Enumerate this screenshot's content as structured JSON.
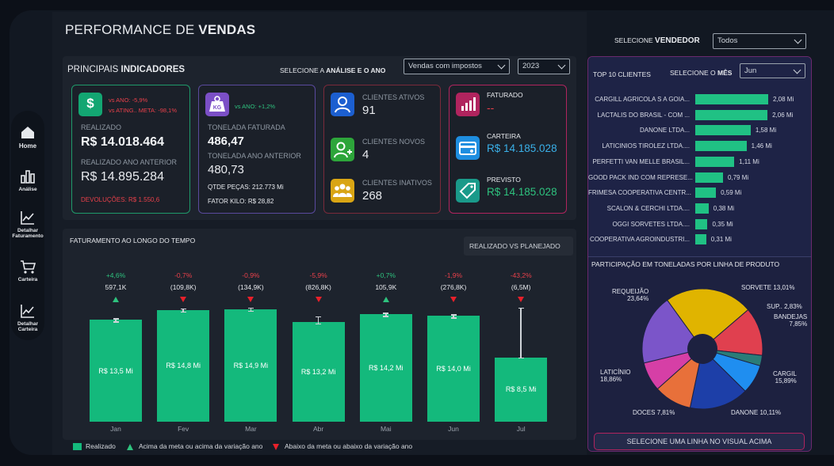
{
  "sidebar": {
    "items": [
      {
        "label": "Home",
        "icon": "home-icon"
      },
      {
        "label": "Análise",
        "icon": "bar-chart-icon"
      },
      {
        "label": "Detalhar Faturamento",
        "icon": "line-chart-icon"
      },
      {
        "label": "Carteira",
        "icon": "cart-icon"
      },
      {
        "label": "Detalhar Carteira",
        "icon": "line-chart-icon"
      }
    ]
  },
  "header": {
    "title_plain": "PERFORMANCE DE ",
    "title_bold": "VENDAS",
    "seller_label_plain": "SELECIONE ",
    "seller_label_bold": "VENDEDOR",
    "seller_value": "Todos"
  },
  "indicators": {
    "title_plain": "PRINCIPAIS ",
    "title_bold": "INDICADORES",
    "select_label_plain": "SELECIONE A ",
    "select_label_bold": "ANÁLISE E O ANO",
    "analysis_value": "Vendas com impostos",
    "year_value": "2023",
    "card1": {
      "vs_ano": "vs ANO: -5,9%",
      "vs_meta": "vs ATING.. META: -98,1%",
      "realizado_label": "REALIZADO",
      "realizado_value": "R$ 14.018.464",
      "anterior_label": "REALIZADO ANO ANTERIOR",
      "anterior_value": "R$ 14.895.284",
      "devolucoes": "DEVOLUÇÕES: R$ 1.550,6"
    },
    "card2": {
      "vs_ano": "vs ANO: +1,2%",
      "faturada_label": "TONELADA FATURADA",
      "faturada_value": "486,47",
      "anterior_label": "TONELADA ANO ANTERIOR",
      "anterior_value": "480,73",
      "qtde": "QTDE PEÇAS: 212.773 Mi",
      "fator": "FATOR KILO: R$ 28,82"
    },
    "card3": {
      "ativos_label": "CLIENTES ATIVOS",
      "ativos_value": "91",
      "novos_label": "CLIENTES NOVOS",
      "novos_value": "4",
      "inativos_label": "CLIENTES INATIVOS",
      "inativos_value": "268"
    },
    "card4": {
      "faturado_label": "FATURADO",
      "faturado_value": "--",
      "carteira_label": "CARTEIRA",
      "carteira_value": "R$ 14.185.028",
      "previsto_label": "PREVISTO",
      "previsto_value": "R$ 14.185.028"
    }
  },
  "colors": {
    "accent_green": "#14b97c",
    "accent_red": "#e8404a",
    "panel_border_purple": "#6b2a6e"
  },
  "billing": {
    "title": "FATURAMENTO AO LONGO DO TEMPO",
    "button": "REALIZADO VS PLANEJADO"
  },
  "chart_data": [
    {
      "type": "bar",
      "categories": [
        "Jan",
        "Fev",
        "Mar",
        "Abr",
        "Mai",
        "Jun",
        "Jul"
      ],
      "values": [
        13.5,
        14.8,
        14.9,
        13.2,
        14.2,
        14.0,
        8.5
      ],
      "labels": [
        "R$ 13,5 Mi",
        "R$ 14,8 Mi",
        "R$ 14,9 Mi",
        "R$ 13,2 Mi",
        "R$ 14,2 Mi",
        "R$ 14,0 Mi",
        "R$ 8,5 Mi"
      ],
      "deltas": [
        "+4,6%",
        "-0,7%",
        "-0,9%",
        "-5,9%",
        "+0,7%",
        "-1,9%",
        "-43,2%"
      ],
      "delta_values": [
        "597,1K",
        "(109,8K)",
        "(134,9K)",
        "(826,8K)",
        "105,9K",
        "(276,8K)",
        "(6,5M)"
      ],
      "direction": [
        "up",
        "down",
        "down",
        "down",
        "up",
        "down",
        "down"
      ],
      "series": [
        {
          "name": "Realizado"
        }
      ],
      "legend": [
        "Realizado",
        "Acima da meta ou acima da variação ano",
        "Abaixo da meta ou abaixo da  variação ano"
      ]
    },
    {
      "type": "bar",
      "title_plain": "TOP 10 CLIENTES",
      "month_label_plain": "SELECIONE O ",
      "month_label_bold": "MÊS",
      "month_value": "Jun",
      "categories": [
        "CARGILL AGRICOLA S A GOIA...",
        "LACTALIS DO BRASIL - COM ...",
        "DANONE LTDA...",
        "LATICINIOS TIROLEZ LTDA....",
        "PERFETTI VAN MELLE BRASIL...",
        "GOOD PACK IND COM REPRESE...",
        "FRIMESA COOPERATIVA CENTR...",
        "SCALON & CERCHI LTDA....",
        "OGGI SORVETES LTDA....",
        "COOPERATIVA AGROINDUSTRI..."
      ],
      "values": [
        2.08,
        2.06,
        1.58,
        1.46,
        1.11,
        0.79,
        0.59,
        0.38,
        0.35,
        0.31
      ],
      "labels": [
        "2,08 Mi",
        "2,06 Mi",
        "1,58 Mi",
        "1,46 Mi",
        "1,11 Mi",
        "0,79 Mi",
        "0,59 Mi",
        "0,38 Mi",
        "0,35 Mi",
        "0,31 Mi"
      ]
    },
    {
      "type": "pie",
      "title": "PARTICIPAÇÃO EM TONELADAS POR LINHA DE PRODUTO",
      "slices": [
        {
          "name": "REQUEIJÃO",
          "value": 23.64,
          "label": "23,64%",
          "color": "#e0b400"
        },
        {
          "name": "SORVETE",
          "value": 13.01,
          "label": "13,01%",
          "color": "#e0404f"
        },
        {
          "name": "SUP..",
          "value": 2.83,
          "label": "2,83%",
          "color": "#2a7c78"
        },
        {
          "name": "BANDEJAS",
          "value": 7.85,
          "label": "7,85%",
          "color": "#1f8ef0"
        },
        {
          "name": "CARGIL",
          "value": 15.89,
          "label": "15,89%",
          "color": "#1d3fa8"
        },
        {
          "name": "DANONE",
          "value": 10.11,
          "label": "10,11%",
          "color": "#e8703a"
        },
        {
          "name": "DOCES",
          "value": 7.81,
          "label": "7,81%",
          "color": "#d63fa6"
        },
        {
          "name": "LATICÍNIO",
          "value": 18.86,
          "label": "18,86%",
          "color": "#7b55c9"
        }
      ],
      "footer_button": "SELECIONE UMA LINHA NO VISUAL ACIMA"
    }
  ]
}
